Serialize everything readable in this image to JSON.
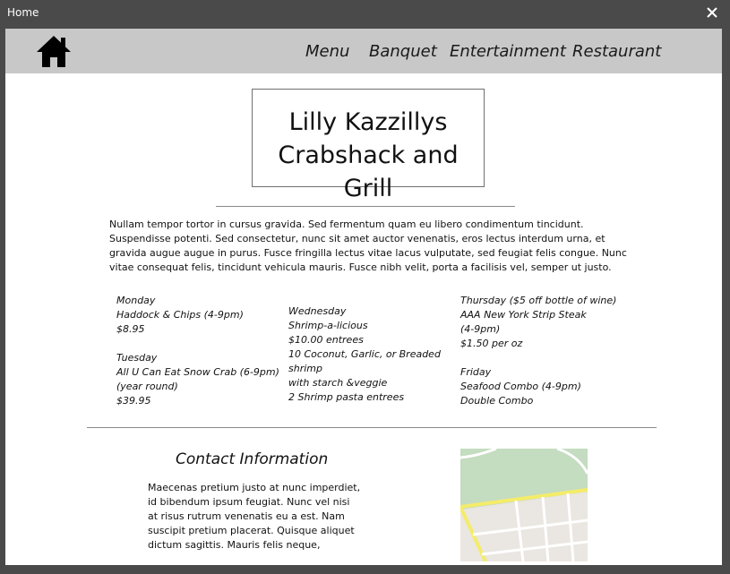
{
  "window": {
    "title": "Home"
  },
  "nav": {
    "items": [
      {
        "label": "Menu"
      },
      {
        "label": "Banquet"
      },
      {
        "label": "Entertainment"
      },
      {
        "label": "Restaurant"
      }
    ]
  },
  "hero": {
    "title_line1": "Lilly Kazzillys",
    "title_line2": "Crabshack and Grill"
  },
  "intro": {
    "text": "Nullam tempor tortor in cursus gravida. Sed fermentum quam eu libero condimentum tincidunt. Suspendisse potenti. Sed consectetur, nunc sit amet auctor venenatis, eros lectus interdum urna, et gravida augue augue in purus. Fusce fringilla lectus vitae lacus vulputate, sed feugiat felis congue. Nunc vitae consequat felis, tincidunt vehicula mauris. Fusce nibh velit, porta a facilisis vel, semper ut justo."
  },
  "specials": {
    "col1": [
      "Monday",
      "Haddock & Chips (4-9pm)",
      "$8.95",
      "",
      "Tuesday",
      "All U Can Eat Snow Crab (6-9pm)",
      "(year round)",
      "$39.95"
    ],
    "col2": [
      "Wednesday",
      "Shrimp-a-licious",
      "$10.00 entrees",
      "10 Coconut, Garlic, or Breaded",
      "shrimp",
      "with starch &veggie",
      "2 Shrimp pasta entrees"
    ],
    "col3": [
      "Thursday ($5 off bottle of wine)",
      "AAA New York Strip Steak",
      "(4-9pm)",
      "$1.50 per oz",
      "",
      "Friday",
      "Seafood Combo  (4-9pm)",
      "Double Combo"
    ]
  },
  "contact": {
    "heading": "Contact Information",
    "body": "Maecenas pretium justo at nunc imperdiet, id bibendum ipsum feugiat. Nunc vel nisi at risus rutrum venenatis eu a est. Nam suscipit pretium placerat. Quisque aliquet dictum sagittis. Mauris felis neque,"
  },
  "icons": {
    "close": "close-icon",
    "home": "home-icon",
    "map": "map-image"
  },
  "colors": {
    "titlebar": "#4a4a4a",
    "navbar": "#c8c8c8",
    "map_park": "#c4dcc0",
    "map_road": "#f4ec6a"
  }
}
